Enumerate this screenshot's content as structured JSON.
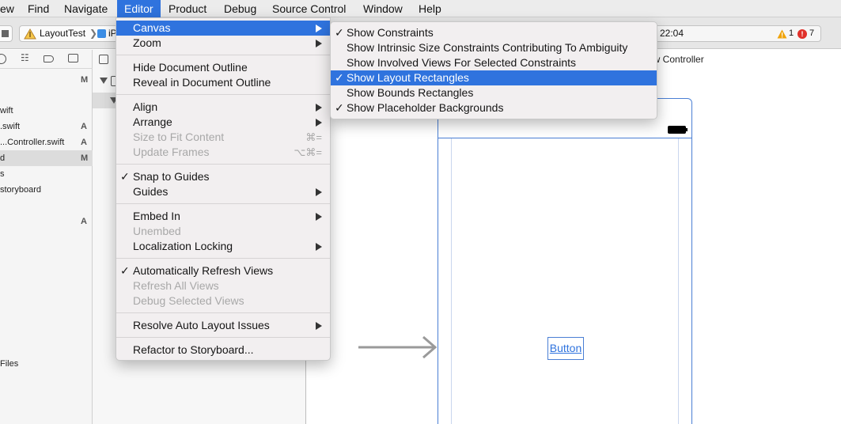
{
  "menubar": {
    "items": [
      {
        "label": "ew"
      },
      {
        "label": "Find"
      },
      {
        "label": "Navigate"
      },
      {
        "label": "Editor"
      },
      {
        "label": "Product"
      },
      {
        "label": "Debug"
      },
      {
        "label": "Source Control"
      },
      {
        "label": "Window"
      },
      {
        "label": "Help"
      }
    ]
  },
  "toolbar": {
    "scheme_name": "LayoutTest",
    "destination_label": "iP",
    "time": "22:04",
    "warning_count": "1",
    "error_count": "7"
  },
  "navigator": {
    "files": [
      {
        "name": "",
        "badge": "M"
      },
      {
        "name": "wift",
        "badge": ""
      },
      {
        "name": ".swift",
        "badge": "A"
      },
      {
        "name": "...Controller.swift",
        "badge": "A"
      },
      {
        "name": "d",
        "badge": "M"
      },
      {
        "name": "s",
        "badge": ""
      },
      {
        "name": "storyboard",
        "badge": ""
      },
      {
        "name": "",
        "badge": "A"
      },
      {
        "name": "Files",
        "badge": ""
      }
    ]
  },
  "canvas": {
    "scene_title": "ew Controller",
    "button_label": "Button"
  },
  "editor_menu": {
    "items": [
      {
        "label": "Canvas",
        "shortcut": ""
      },
      {
        "label": "Zoom",
        "shortcut": ""
      },
      {
        "label": "Hide Document Outline",
        "shortcut": ""
      },
      {
        "label": "Reveal in Document Outline",
        "shortcut": ""
      },
      {
        "label": "Align",
        "shortcut": ""
      },
      {
        "label": "Arrange",
        "shortcut": ""
      },
      {
        "label": "Size to Fit Content",
        "shortcut": "⌘="
      },
      {
        "label": "Update Frames",
        "shortcut": "⌥⌘="
      },
      {
        "label": "Snap to Guides",
        "shortcut": ""
      },
      {
        "label": "Guides",
        "shortcut": ""
      },
      {
        "label": "Embed In",
        "shortcut": ""
      },
      {
        "label": "Unembed",
        "shortcut": ""
      },
      {
        "label": "Localization Locking",
        "shortcut": ""
      },
      {
        "label": "Automatically Refresh Views",
        "shortcut": ""
      },
      {
        "label": "Refresh All Views",
        "shortcut": ""
      },
      {
        "label": "Debug Selected Views",
        "shortcut": ""
      },
      {
        "label": "Resolve Auto Layout Issues",
        "shortcut": ""
      },
      {
        "label": "Refactor to Storyboard...",
        "shortcut": ""
      }
    ]
  },
  "canvas_submenu": {
    "items": [
      {
        "label": "Show Constraints",
        "checked": true
      },
      {
        "label": "Show Intrinsic Size Constraints Contributing To Ambiguity",
        "checked": false
      },
      {
        "label": "Show Involved Views For Selected Constraints",
        "checked": false
      },
      {
        "label": "Show Layout Rectangles",
        "checked": true
      },
      {
        "label": "Show Bounds Rectangles",
        "checked": false
      },
      {
        "label": "Show Placeholder Backgrounds",
        "checked": true
      }
    ]
  },
  "colors": {
    "accent": "#2f73de",
    "warning": "#f0a30a",
    "error": "#e0302a",
    "scene_border": "#4a7fd4"
  }
}
